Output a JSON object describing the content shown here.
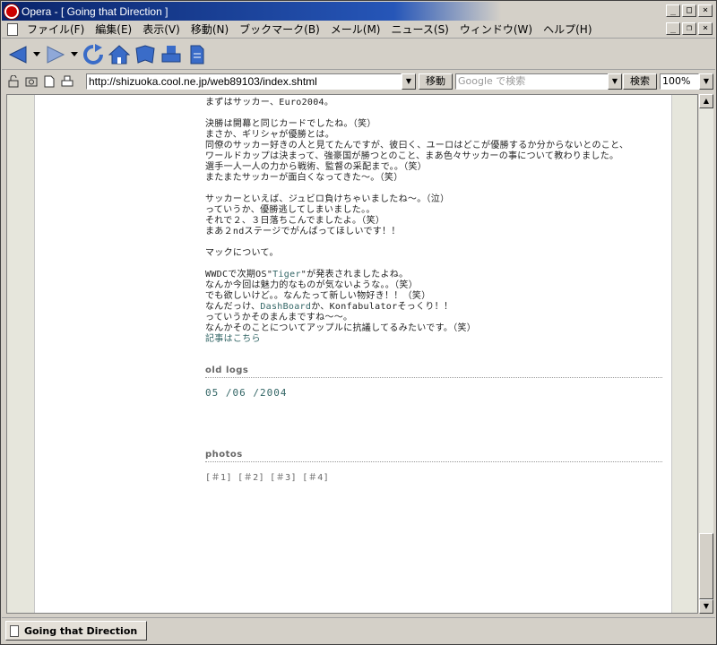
{
  "window": {
    "title": "Opera - [ Going that Direction ]",
    "minimize": "_",
    "maximize": "□",
    "close": "×",
    "mdi_minimize": "_",
    "mdi_restore": "❐",
    "mdi_close": "×"
  },
  "menu": [
    "ファイル(F)",
    "編集(E)",
    "表示(V)",
    "移動(N)",
    "ブックマーク(B)",
    "メール(M)",
    "ニュース(S)",
    "ウィンドウ(W)",
    "ヘルプ(H)"
  ],
  "toolbar": {
    "icons": [
      "back-icon",
      "forward-icon",
      "reload-icon",
      "home-icon",
      "hotlist-icon",
      "print-icon",
      "document-icon"
    ]
  },
  "address": {
    "url": "http://shizuoka.cool.ne.jp/web89103/index.shtml",
    "go_label": "移動",
    "search_placeholder": "Google で検索",
    "search_label": "検索",
    "zoom": "100%"
  },
  "article": {
    "lines": [
      "まずはサッカー、Euro2004。",
      "",
      "決勝は開幕と同じカードでしたね。（笑）",
      "まさか、ギリシャが優勝とは。",
      "同僚のサッカー好きの人と見てたんですが、彼曰く、ユーロはどこが優勝するか分からないとのこと、",
      "ワールドカップは決まって、強豪国が勝つとのこと、まあ色々サッカーの事について教わりました。",
      "選手一人一人の力から戦術、監督の采配まで。。（笑）",
      "またまたサッカーが面白くなってきた〜。（笑）",
      "",
      "サッカーといえば、ジュビロ負けちゃいましたね〜。（泣）",
      "っていうか、優勝逃してしまいました。。",
      "それで２、３日落ちこんでましたよ。（笑）",
      "まあ２ndステージでがんばってほしいです！！",
      "",
      "マックについて。",
      ""
    ],
    "wwdc_pre": "WWDCで次期OS\"",
    "wwdc_link": "Tiger",
    "wwdc_post": "\"が発表されましたよね。",
    "lines2": [
      "なんか今回は魅力的なものが気ないような。。（笑）",
      "でも欲しいけど。。なんたって新しい物好き！！（笑）"
    ],
    "dash_pre": "なんだっけ、",
    "dash_link": "DashBoard",
    "dash_post": "か、Konfabulatorそっくり！！",
    "lines3": [
      "っていうかそのまんまですね〜〜。",
      "なんかそのことについてアップルに抗議してるみたいです。（笑）"
    ],
    "more_link": "記事はこちら"
  },
  "sidebar": {
    "old_logs_heading": "old logs",
    "old_logs_date": "05 /06 /2004",
    "photos_heading": "photos",
    "photos": [
      "[＃1]",
      "[＃2]",
      "[＃3]",
      "[＃4]"
    ]
  },
  "tabbar": {
    "tab_label": "Going that Direction"
  }
}
